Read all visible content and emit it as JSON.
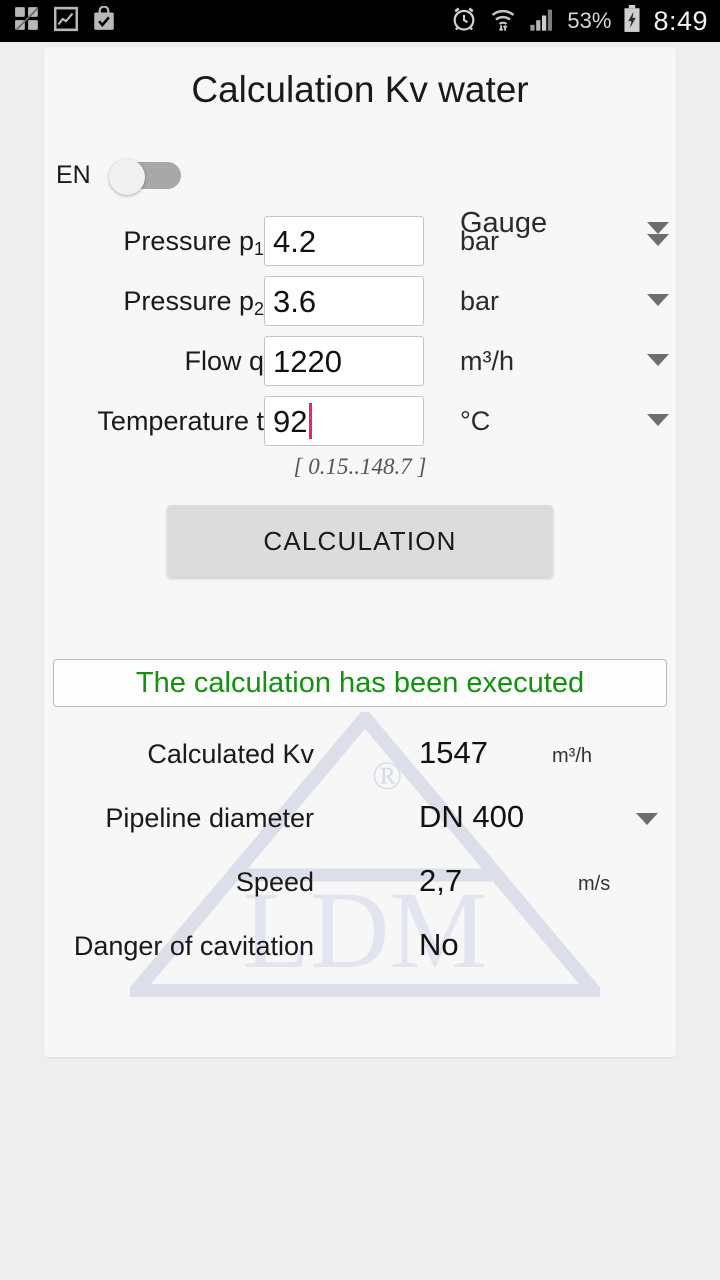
{
  "statusbar": {
    "icons_left": [
      "antivirus-shield-icon",
      "photo-frame-icon",
      "shopping-bag-check-icon"
    ],
    "icons_right": [
      "alarm-clock-icon",
      "wifi-transfer-icon",
      "signal-bars-icon",
      "battery-charging-icon"
    ],
    "battery_percent": "53%",
    "time": "8:49"
  },
  "app": {
    "title": "Calculation Kv water",
    "language_label": "EN",
    "language_toggle_state": "off",
    "pressure_reference": "Gauge"
  },
  "inputs": [
    {
      "label": "Pressure p",
      "sub": "1",
      "value": "4.2",
      "unit": "bar",
      "focused": false
    },
    {
      "label": "Pressure p",
      "sub": "2",
      "value": "3.6",
      "unit": "bar",
      "focused": false
    },
    {
      "label": "Flow q",
      "sub": "",
      "value": "1220",
      "unit": "m³/h",
      "focused": false
    },
    {
      "label": "Temperature t",
      "sub": "",
      "value": "92",
      "unit": "°C",
      "focused": true
    }
  ],
  "range_hint": "[ 0.15..148.7 ]",
  "calculate_button": "CALCULATION",
  "result_message": "The calculation has been executed",
  "results": [
    {
      "label": "Calculated Kv",
      "value": "1547",
      "unit": "m³/h",
      "has_dropdown": false
    },
    {
      "label": "Pipeline diameter",
      "value": "DN 400",
      "unit": "",
      "has_dropdown": true
    },
    {
      "label": "Speed",
      "value": "2,7",
      "unit": "m/s",
      "has_dropdown": false
    },
    {
      "label": "Danger of cavitation",
      "value": "No",
      "unit": "",
      "has_dropdown": false
    }
  ],
  "watermark": {
    "brand": "LDM",
    "registered_mark": "®"
  },
  "colors": {
    "page_background": "#eeeeee",
    "card_background": "#f7f7f7",
    "success_text": "#12920f",
    "text_cursor": "#e8246c",
    "button_background": "#dcdcdc",
    "watermark": "#dcdfea"
  }
}
